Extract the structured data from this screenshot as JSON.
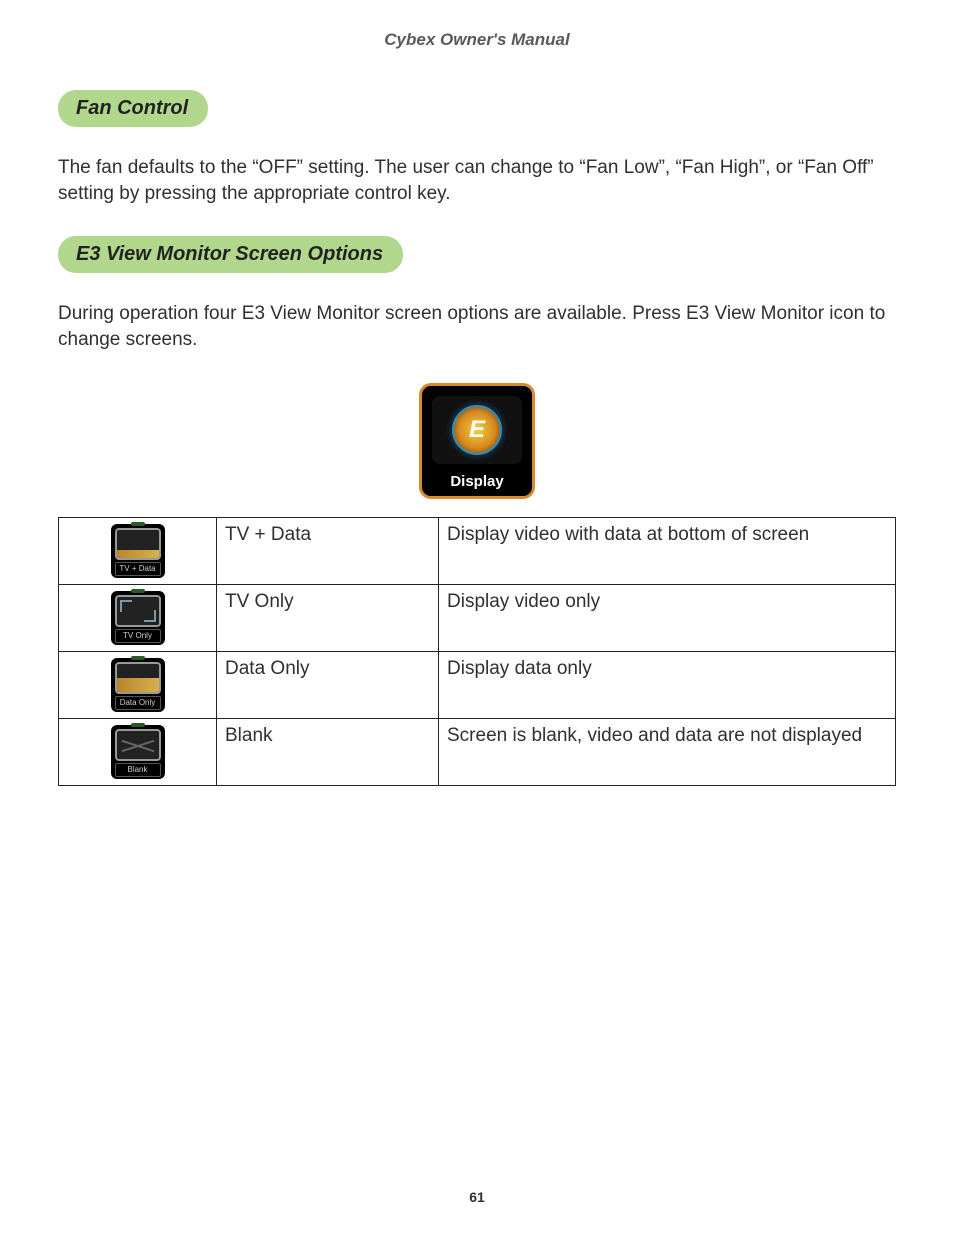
{
  "doc_title": "Cybex Owner's Manual",
  "sections": {
    "fan": {
      "heading": "Fan Control",
      "body": "The fan defaults to the “OFF” setting. The user can change to “Fan Low”, “Fan High”, or “Fan Off” setting by pressing the appropriate control key."
    },
    "e3": {
      "heading": "E3 View Monitor Screen Options",
      "body": "During operation four E3 View Monitor screen options are available. Press E3 View Monitor icon to change screens."
    }
  },
  "display_icon": {
    "badge": "E",
    "label": "Display"
  },
  "table": {
    "rows": [
      {
        "icon_label": "TV + Data",
        "mode": "TV + Data",
        "desc": "Display video with data at bottom of screen"
      },
      {
        "icon_label": "TV Only",
        "mode": "TV Only",
        "desc": "Display video only"
      },
      {
        "icon_label": "Data Only",
        "mode": "Data Only",
        "desc": "Display data only"
      },
      {
        "icon_label": "Blank",
        "mode": "Blank",
        "desc": "Screen is blank, video and data are not displayed"
      }
    ]
  },
  "page_number": "61"
}
